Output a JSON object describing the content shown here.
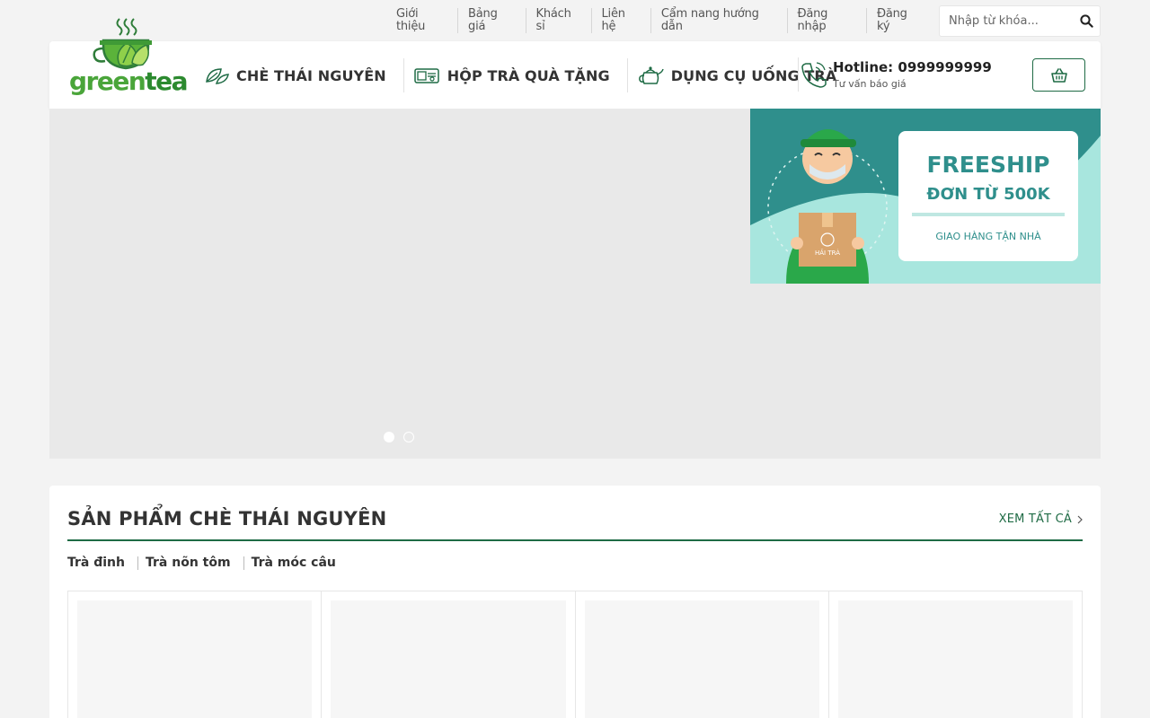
{
  "topbar": {
    "links": [
      "Giới thiệu",
      "Bảng giá",
      "Khách sỉ",
      "Liên hệ",
      "Cẩm nang hướng dẫn",
      "Đăng nhập",
      "Đăng ký"
    ],
    "search_placeholder": "Nhập từ khóa...",
    "search_icon": "search-icon"
  },
  "logo": {
    "part1": "green",
    "part2": "tea"
  },
  "nav": {
    "items": [
      {
        "label": "CHÈ THÁI NGUYÊN",
        "icon": "tea-leaf-icon"
      },
      {
        "label": "HỘP TRÀ QUÀ TẶNG",
        "icon": "gift-box-icon"
      },
      {
        "label": "DỤNG CỤ UỐNG TRÀ",
        "icon": "teapot-icon"
      }
    ]
  },
  "hotline": {
    "number": "Hotline: 0999999999",
    "sub": "Tư vấn báo giá",
    "icon": "phone-icon"
  },
  "cart": {
    "icon": "basket-icon"
  },
  "promo": {
    "line1": "FREESHIP",
    "line2": "ĐƠN TỪ 500K",
    "line3": "GIAO HÀNG TẬN NHÀ",
    "box_label": "HẢI TRÀ"
  },
  "colors": {
    "brand_green": "#1f6b45",
    "logo_green": "#4aa53a",
    "promo_teal": "#2f8f8c"
  },
  "products": {
    "title": "SẢN PHẨM CHÈ THÁI NGUYÊN",
    "see_all": "XEM TẤT CẢ",
    "tabs": [
      "Trà đinh",
      "Trà nõn tôm",
      "Trà móc câu"
    ]
  }
}
